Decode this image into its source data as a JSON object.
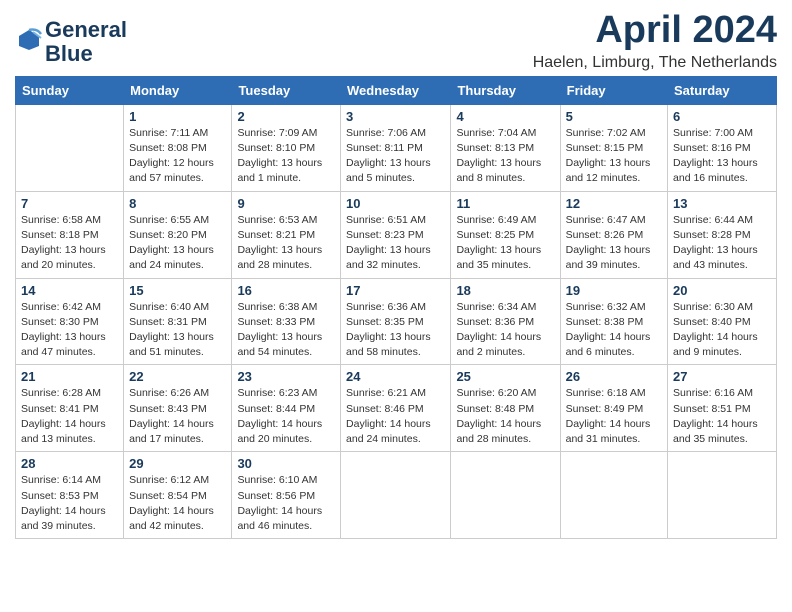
{
  "header": {
    "logo_line1": "General",
    "logo_line2": "Blue",
    "month": "April 2024",
    "location": "Haelen, Limburg, The Netherlands"
  },
  "days_of_week": [
    "Sunday",
    "Monday",
    "Tuesday",
    "Wednesday",
    "Thursday",
    "Friday",
    "Saturday"
  ],
  "weeks": [
    [
      {
        "day": "",
        "info": ""
      },
      {
        "day": "1",
        "info": "Sunrise: 7:11 AM\nSunset: 8:08 PM\nDaylight: 12 hours\nand 57 minutes."
      },
      {
        "day": "2",
        "info": "Sunrise: 7:09 AM\nSunset: 8:10 PM\nDaylight: 13 hours\nand 1 minute."
      },
      {
        "day": "3",
        "info": "Sunrise: 7:06 AM\nSunset: 8:11 PM\nDaylight: 13 hours\nand 5 minutes."
      },
      {
        "day": "4",
        "info": "Sunrise: 7:04 AM\nSunset: 8:13 PM\nDaylight: 13 hours\nand 8 minutes."
      },
      {
        "day": "5",
        "info": "Sunrise: 7:02 AM\nSunset: 8:15 PM\nDaylight: 13 hours\nand 12 minutes."
      },
      {
        "day": "6",
        "info": "Sunrise: 7:00 AM\nSunset: 8:16 PM\nDaylight: 13 hours\nand 16 minutes."
      }
    ],
    [
      {
        "day": "7",
        "info": "Sunrise: 6:58 AM\nSunset: 8:18 PM\nDaylight: 13 hours\nand 20 minutes."
      },
      {
        "day": "8",
        "info": "Sunrise: 6:55 AM\nSunset: 8:20 PM\nDaylight: 13 hours\nand 24 minutes."
      },
      {
        "day": "9",
        "info": "Sunrise: 6:53 AM\nSunset: 8:21 PM\nDaylight: 13 hours\nand 28 minutes."
      },
      {
        "day": "10",
        "info": "Sunrise: 6:51 AM\nSunset: 8:23 PM\nDaylight: 13 hours\nand 32 minutes."
      },
      {
        "day": "11",
        "info": "Sunrise: 6:49 AM\nSunset: 8:25 PM\nDaylight: 13 hours\nand 35 minutes."
      },
      {
        "day": "12",
        "info": "Sunrise: 6:47 AM\nSunset: 8:26 PM\nDaylight: 13 hours\nand 39 minutes."
      },
      {
        "day": "13",
        "info": "Sunrise: 6:44 AM\nSunset: 8:28 PM\nDaylight: 13 hours\nand 43 minutes."
      }
    ],
    [
      {
        "day": "14",
        "info": "Sunrise: 6:42 AM\nSunset: 8:30 PM\nDaylight: 13 hours\nand 47 minutes."
      },
      {
        "day": "15",
        "info": "Sunrise: 6:40 AM\nSunset: 8:31 PM\nDaylight: 13 hours\nand 51 minutes."
      },
      {
        "day": "16",
        "info": "Sunrise: 6:38 AM\nSunset: 8:33 PM\nDaylight: 13 hours\nand 54 minutes."
      },
      {
        "day": "17",
        "info": "Sunrise: 6:36 AM\nSunset: 8:35 PM\nDaylight: 13 hours\nand 58 minutes."
      },
      {
        "day": "18",
        "info": "Sunrise: 6:34 AM\nSunset: 8:36 PM\nDaylight: 14 hours\nand 2 minutes."
      },
      {
        "day": "19",
        "info": "Sunrise: 6:32 AM\nSunset: 8:38 PM\nDaylight: 14 hours\nand 6 minutes."
      },
      {
        "day": "20",
        "info": "Sunrise: 6:30 AM\nSunset: 8:40 PM\nDaylight: 14 hours\nand 9 minutes."
      }
    ],
    [
      {
        "day": "21",
        "info": "Sunrise: 6:28 AM\nSunset: 8:41 PM\nDaylight: 14 hours\nand 13 minutes."
      },
      {
        "day": "22",
        "info": "Sunrise: 6:26 AM\nSunset: 8:43 PM\nDaylight: 14 hours\nand 17 minutes."
      },
      {
        "day": "23",
        "info": "Sunrise: 6:23 AM\nSunset: 8:44 PM\nDaylight: 14 hours\nand 20 minutes."
      },
      {
        "day": "24",
        "info": "Sunrise: 6:21 AM\nSunset: 8:46 PM\nDaylight: 14 hours\nand 24 minutes."
      },
      {
        "day": "25",
        "info": "Sunrise: 6:20 AM\nSunset: 8:48 PM\nDaylight: 14 hours\nand 28 minutes."
      },
      {
        "day": "26",
        "info": "Sunrise: 6:18 AM\nSunset: 8:49 PM\nDaylight: 14 hours\nand 31 minutes."
      },
      {
        "day": "27",
        "info": "Sunrise: 6:16 AM\nSunset: 8:51 PM\nDaylight: 14 hours\nand 35 minutes."
      }
    ],
    [
      {
        "day": "28",
        "info": "Sunrise: 6:14 AM\nSunset: 8:53 PM\nDaylight: 14 hours\nand 39 minutes."
      },
      {
        "day": "29",
        "info": "Sunrise: 6:12 AM\nSunset: 8:54 PM\nDaylight: 14 hours\nand 42 minutes."
      },
      {
        "day": "30",
        "info": "Sunrise: 6:10 AM\nSunset: 8:56 PM\nDaylight: 14 hours\nand 46 minutes."
      },
      {
        "day": "",
        "info": ""
      },
      {
        "day": "",
        "info": ""
      },
      {
        "day": "",
        "info": ""
      },
      {
        "day": "",
        "info": ""
      }
    ]
  ]
}
